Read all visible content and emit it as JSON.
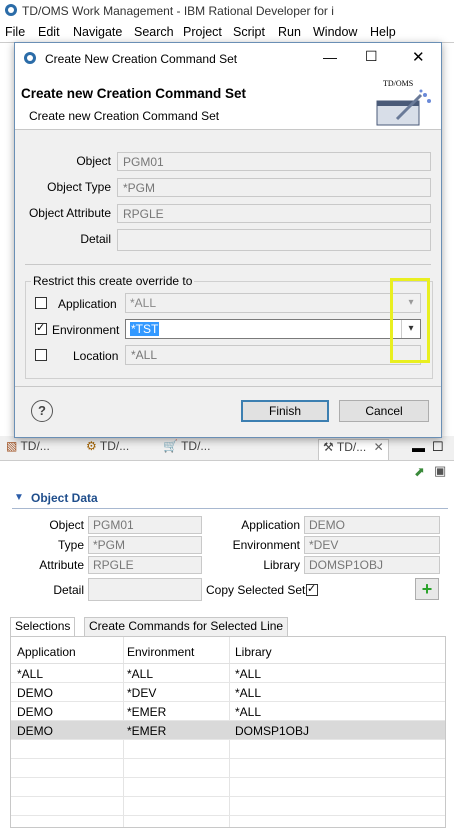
{
  "app": {
    "title": "TD/OMS Work Management - IBM Rational Developer for i",
    "menu": [
      "File",
      "Edit",
      "Navigate",
      "Search",
      "Project",
      "Script",
      "Run",
      "Window",
      "Help"
    ]
  },
  "dialog": {
    "title": "Create New Creation Command Set",
    "header_title": "Create new Creation Command Set",
    "header_subtitle": "Create new Creation Command Set",
    "logo_text": "TD/OMS",
    "fields": {
      "object_label": "Object",
      "object_value": "PGM01",
      "object_type_label": "Object Type",
      "object_type_value": "*PGM",
      "object_attr_label": "Object Attribute",
      "object_attr_value": "RPGLE",
      "detail_label": "Detail",
      "detail_value": ""
    },
    "restrict": {
      "title": "Restrict this create override to",
      "application_label": "Application",
      "application_value": "*ALL",
      "application_checked": false,
      "environment_label": "Environment",
      "environment_value": "*TST",
      "environment_checked": true,
      "location_label": "Location",
      "location_value": "*ALL",
      "location_checked": false
    },
    "finish_label": "Finish",
    "cancel_label": "Cancel",
    "help_symbol": "?"
  },
  "tabs": [
    "TD/...",
    "TD/...",
    "TD/...",
    "TD/..."
  ],
  "object_data": {
    "section_title": "Object Data",
    "object_label": "Object",
    "object_value": "PGM01",
    "type_label": "Type",
    "type_value": "*PGM",
    "attribute_label": "Attribute",
    "attribute_value": "RPGLE",
    "detail_label": "Detail",
    "detail_value": "",
    "application_label": "Application",
    "application_value": "DEMO",
    "environment_label": "Environment",
    "environment_value": "*DEV",
    "library_label": "Library",
    "library_value": "DOMSP1OBJ",
    "copy_label": "Copy Selected Set",
    "copy_checked": true
  },
  "subtabs": [
    "Selections",
    "Create Commands for Selected Line"
  ],
  "table": {
    "columns": [
      "Application",
      "Environment",
      "Library"
    ],
    "rows": [
      [
        "*ALL",
        "*ALL",
        "*ALL"
      ],
      [
        "DEMO",
        "*DEV",
        "*ALL"
      ],
      [
        "DEMO",
        "*EMER",
        "*ALL"
      ],
      [
        "DEMO",
        "*EMER",
        "DOMSP1OBJ"
      ]
    ],
    "selected_row": 3
  },
  "colors": {
    "accent": "#3c7fb1",
    "highlight": "#e9ef20",
    "selection": "#3399ff"
  }
}
